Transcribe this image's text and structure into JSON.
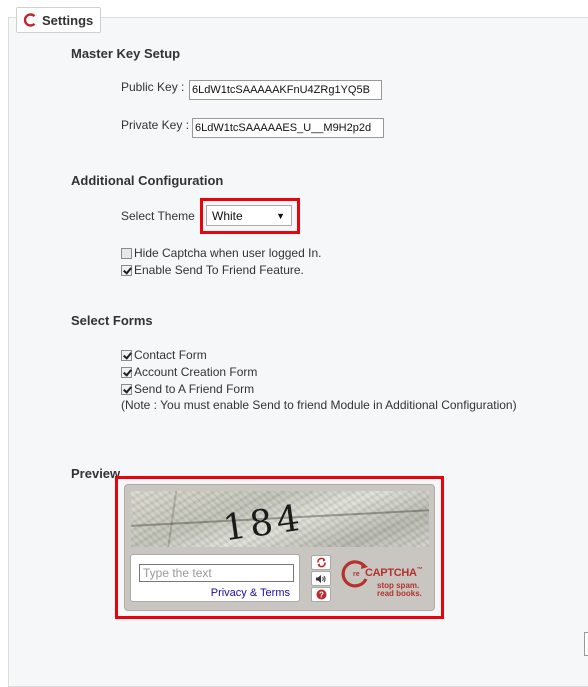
{
  "settings_title": "Settings",
  "master_key": {
    "heading": "Master Key Setup",
    "public_label": "Public Key :",
    "public_value": "6LdW1tcSAAAAAKFnU4ZRg1YQ5B",
    "private_label": "Private Key :",
    "private_value": "6LdW1tcSAAAAAES_U__M9H2p2d"
  },
  "additional": {
    "heading": "Additional Configuration",
    "theme_label": "Select Theme",
    "theme_value": "White",
    "options": [
      {
        "label": "Hide Captcha when user logged In.",
        "checked": false
      },
      {
        "label": "Enable Send To Friend Feature.",
        "checked": true
      }
    ]
  },
  "forms": {
    "heading": "Select Forms",
    "items": [
      {
        "label": "Contact Form",
        "checked": true
      },
      {
        "label": "Account Creation Form",
        "checked": true
      },
      {
        "label": "Send to A Friend Form",
        "checked": true
      }
    ],
    "note": "(Note : You must enable Send to friend Module in Additional Configuration)"
  },
  "preview": {
    "heading": "Preview",
    "captcha_word": "184",
    "input_placeholder": "Type the text",
    "privacy_link": "Privacy & Terms",
    "logo_re": "re",
    "logo_name": "CAPTCHA",
    "logo_tm": "™",
    "tagline_1": "stop spam.",
    "tagline_2": "read books."
  },
  "colors": {
    "highlight": "#e8040c",
    "recaptcha_red": "#b4322b",
    "link": "#1a0dab"
  },
  "icons": [
    "settings-logo-icon",
    "refresh-icon",
    "audio-icon",
    "help-icon",
    "dropdown-arrow-icon"
  ]
}
